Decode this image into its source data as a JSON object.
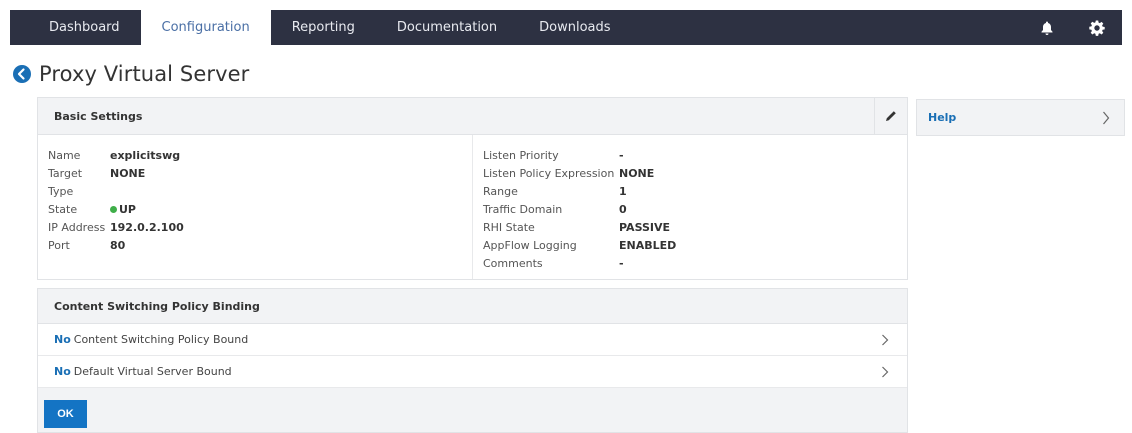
{
  "nav": {
    "tabs": [
      {
        "label": "Dashboard",
        "active": false
      },
      {
        "label": "Configuration",
        "active": true
      },
      {
        "label": "Reporting",
        "active": false
      },
      {
        "label": "Documentation",
        "active": false
      },
      {
        "label": "Downloads",
        "active": false
      }
    ],
    "icons": [
      "bell-icon",
      "gear-icon"
    ]
  },
  "page": {
    "title": "Proxy Virtual Server",
    "back_icon": "back-arrow-icon"
  },
  "basic_settings": {
    "heading": "Basic Settings",
    "left": [
      {
        "key": "Name",
        "value": "explicitswg"
      },
      {
        "key": "Target Type",
        "value": "NONE"
      },
      {
        "key": "State",
        "value": "UP"
      },
      {
        "key": "IP Address",
        "value": "192.0.2.100"
      },
      {
        "key": "Port",
        "value": "80"
      }
    ],
    "right": [
      {
        "key": "Listen Priority",
        "value": "-"
      },
      {
        "key": "Listen Policy Expression",
        "value": "NONE"
      },
      {
        "key": "Range",
        "value": "1"
      },
      {
        "key": "Traffic Domain",
        "value": "0"
      },
      {
        "key": "RHI State",
        "value": "PASSIVE"
      },
      {
        "key": "AppFlow Logging",
        "value": "ENABLED"
      },
      {
        "key": "Comments",
        "value": "-"
      }
    ]
  },
  "binding": {
    "heading": "Content Switching Policy Binding",
    "rows": [
      {
        "prefix": "No",
        "text": "Content Switching Policy Bound"
      },
      {
        "prefix": "No",
        "text": "Default Virtual Server Bound"
      }
    ],
    "ok_label": "OK"
  },
  "help": {
    "label": "Help"
  },
  "colors": {
    "nav_bg": "#2d3142",
    "accent": "#1474c4",
    "link": "#1a6fb5",
    "status_up": "#3fae49"
  }
}
